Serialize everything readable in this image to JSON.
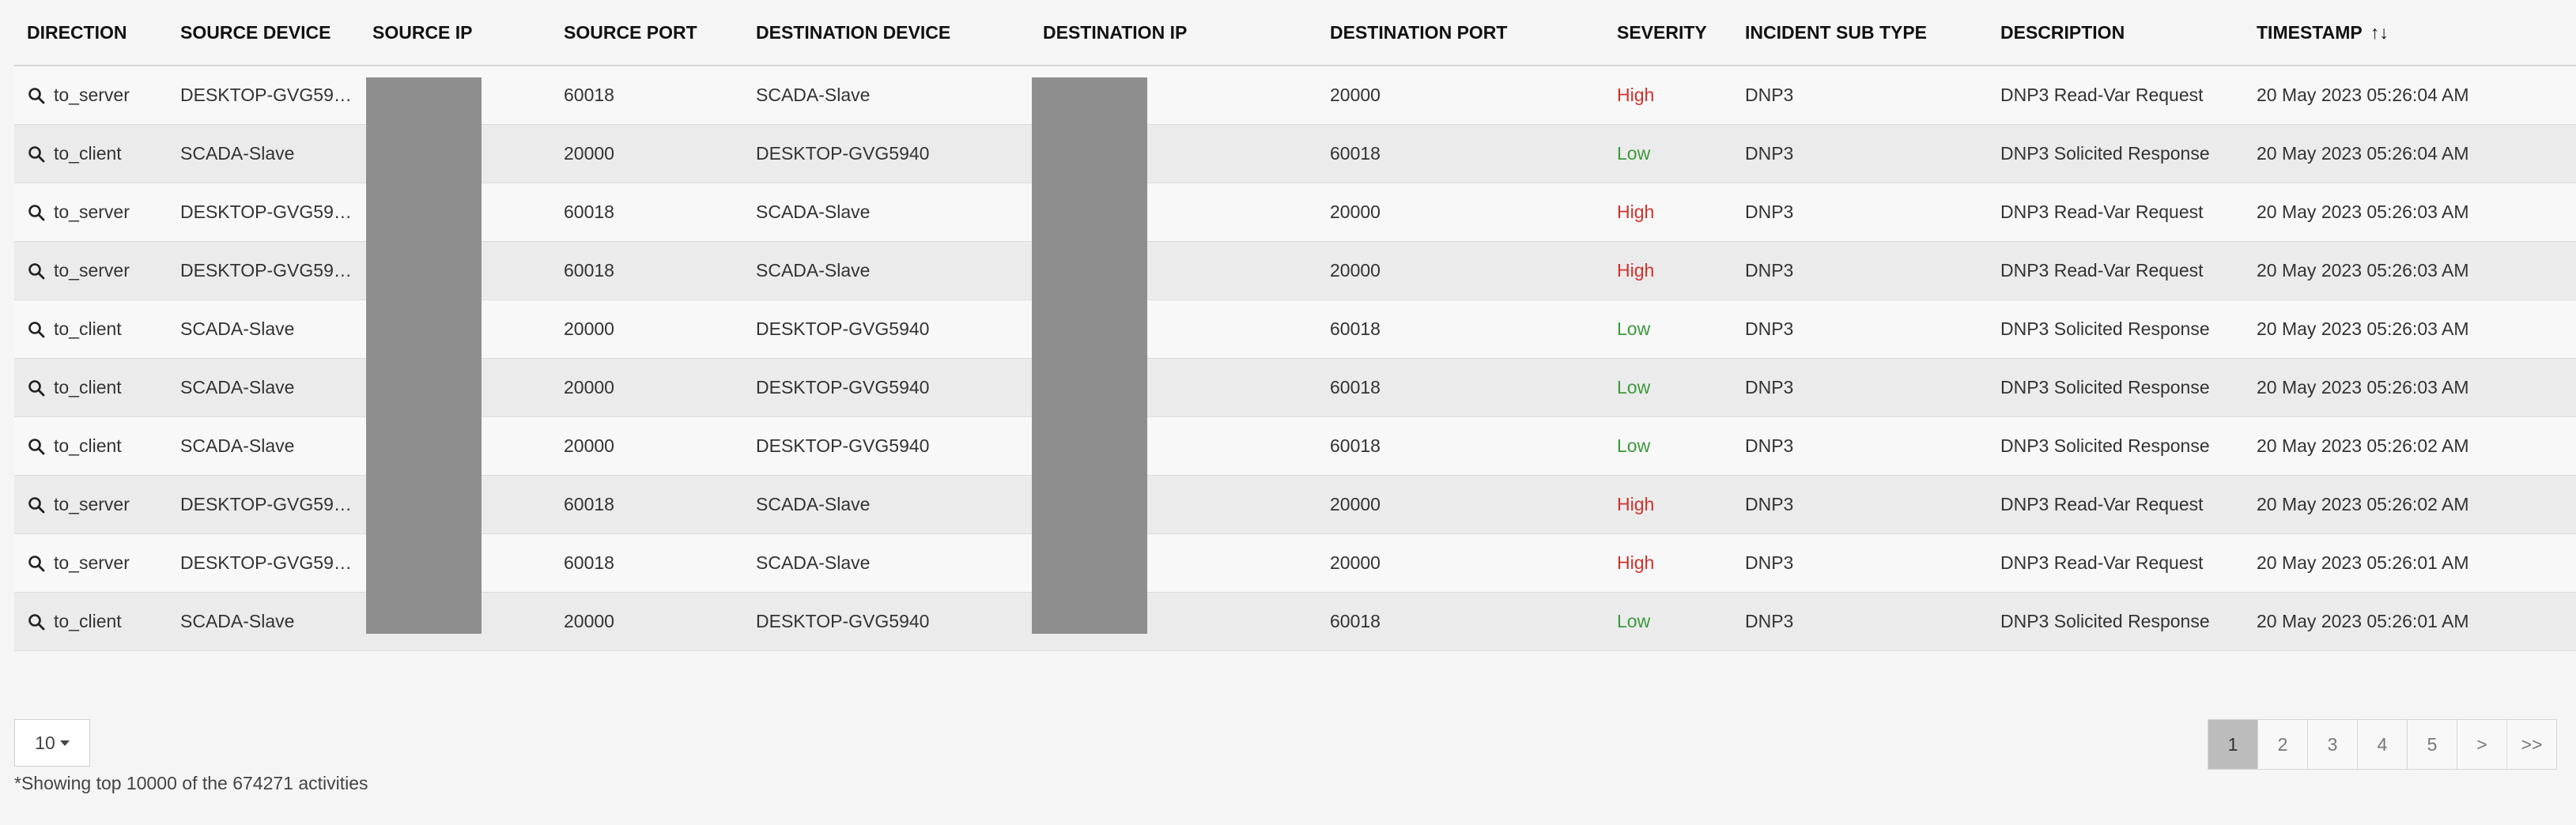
{
  "columns": [
    "DIRECTION",
    "SOURCE DEVICE",
    "SOURCE IP",
    "SOURCE PORT",
    "DESTINATION DEVICE",
    "DESTINATION IP",
    "DESTINATION PORT",
    "SEVERITY",
    "INCIDENT SUB TYPE",
    "DESCRIPTION",
    "TIMESTAMP"
  ],
  "sort_indicator": "↑↓",
  "rows": [
    {
      "direction": "to_server",
      "source_device": "DESKTOP-GVG59…",
      "source_port": "60018",
      "destination_device": "SCADA-Slave",
      "destination_port": "20000",
      "severity": "High",
      "sub_type": "DNP3",
      "description": "DNP3 Read-Var Request",
      "timestamp": "20 May 2023 05:26:04 AM"
    },
    {
      "direction": "to_client",
      "source_device": "SCADA-Slave",
      "source_port": "20000",
      "destination_device": "DESKTOP-GVG5940",
      "destination_port": "60018",
      "severity": "Low",
      "sub_type": "DNP3",
      "description": "DNP3 Solicited Response",
      "timestamp": "20 May 2023 05:26:04 AM"
    },
    {
      "direction": "to_server",
      "source_device": "DESKTOP-GVG59…",
      "source_port": "60018",
      "destination_device": "SCADA-Slave",
      "destination_port": "20000",
      "severity": "High",
      "sub_type": "DNP3",
      "description": "DNP3 Read-Var Request",
      "timestamp": "20 May 2023 05:26:03 AM"
    },
    {
      "direction": "to_server",
      "source_device": "DESKTOP-GVG59…",
      "source_port": "60018",
      "destination_device": "SCADA-Slave",
      "destination_port": "20000",
      "severity": "High",
      "sub_type": "DNP3",
      "description": "DNP3 Read-Var Request",
      "timestamp": "20 May 2023 05:26:03 AM"
    },
    {
      "direction": "to_client",
      "source_device": "SCADA-Slave",
      "source_port": "20000",
      "destination_device": "DESKTOP-GVG5940",
      "destination_port": "60018",
      "severity": "Low",
      "sub_type": "DNP3",
      "description": "DNP3 Solicited Response",
      "timestamp": "20 May 2023 05:26:03 AM"
    },
    {
      "direction": "to_client",
      "source_device": "SCADA-Slave",
      "source_port": "20000",
      "destination_device": "DESKTOP-GVG5940",
      "destination_port": "60018",
      "severity": "Low",
      "sub_type": "DNP3",
      "description": "DNP3 Solicited Response",
      "timestamp": "20 May 2023 05:26:03 AM"
    },
    {
      "direction": "to_client",
      "source_device": "SCADA-Slave",
      "source_port": "20000",
      "destination_device": "DESKTOP-GVG5940",
      "destination_port": "60018",
      "severity": "Low",
      "sub_type": "DNP3",
      "description": "DNP3 Solicited Response",
      "timestamp": "20 May 2023 05:26:02 AM"
    },
    {
      "direction": "to_server",
      "source_device": "DESKTOP-GVG59…",
      "source_port": "60018",
      "destination_device": "SCADA-Slave",
      "destination_port": "20000",
      "severity": "High",
      "sub_type": "DNP3",
      "description": "DNP3 Read-Var Request",
      "timestamp": "20 May 2023 05:26:02 AM"
    },
    {
      "direction": "to_server",
      "source_device": "DESKTOP-GVG59…",
      "source_port": "60018",
      "destination_device": "SCADA-Slave",
      "destination_port": "20000",
      "severity": "High",
      "sub_type": "DNP3",
      "description": "DNP3 Read-Var Request",
      "timestamp": "20 May 2023 05:26:01 AM"
    },
    {
      "direction": "to_client",
      "source_device": "SCADA-Slave",
      "source_port": "20000",
      "destination_device": "DESKTOP-GVG5940",
      "destination_port": "60018",
      "severity": "Low",
      "sub_type": "DNP3",
      "description": "DNP3 Solicited Response",
      "timestamp": "20 May 2023 05:26:01 AM"
    }
  ],
  "severity_colors": {
    "High": "#d0312d",
    "Low": "#3c9a3c"
  },
  "row_icon": "search-icon",
  "page_size": "10",
  "footnote": "*Showing top 10000 of the 674271 activities",
  "pagination": {
    "pages": [
      "1",
      "2",
      "3",
      "4",
      "5"
    ],
    "active": "1",
    "next": ">",
    "last": ">>"
  }
}
